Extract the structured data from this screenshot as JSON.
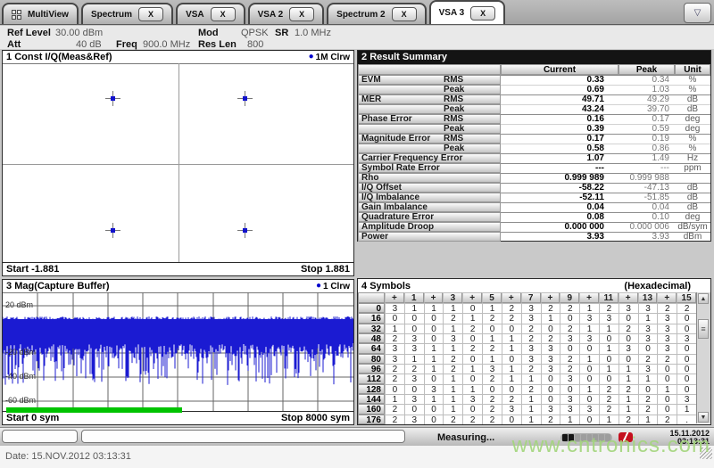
{
  "tabs": {
    "close_label": "X",
    "overflow_button": "▽",
    "items": [
      {
        "label": "MultiView",
        "icon": "grid",
        "closable": false,
        "active": false
      },
      {
        "label": "Spectrum",
        "closable": true,
        "active": false
      },
      {
        "label": "VSA",
        "closable": true,
        "active": false
      },
      {
        "label": "VSA 2",
        "closable": true,
        "active": false
      },
      {
        "label": "Spectrum 2",
        "closable": true,
        "active": false
      },
      {
        "label": "VSA 3",
        "closable": true,
        "active": true
      }
    ]
  },
  "infobar": {
    "ref_level": {
      "label": "Ref Level",
      "value": "30.00 dBm"
    },
    "att": {
      "label": "Att",
      "value": "40 dB"
    },
    "freq": {
      "label": "Freq",
      "value": "900.0 MHz"
    },
    "mod": {
      "label": "Mod",
      "value": "QPSK"
    },
    "sr": {
      "label": "SR",
      "value": "1.0 MHz"
    },
    "res_len": {
      "label": "Res Len",
      "value": "800"
    }
  },
  "panels": {
    "const_iq": {
      "num": "1",
      "title": "Const I/Q(Meas&Ref)",
      "legend_marker": "●",
      "legend": "1M Clrw",
      "start": "Start -1.881",
      "stop": "Stop 1.881",
      "x_range": [
        -1.881,
        1.881
      ],
      "points": [
        {
          "i": -0.707,
          "q": 0.707
        },
        {
          "i": 0.707,
          "q": 0.707
        },
        {
          "i": -0.707,
          "q": -0.707
        },
        {
          "i": 0.707,
          "q": -0.707
        }
      ]
    },
    "result_summary": {
      "num": "2",
      "title": "Result Summary",
      "columns": [
        "Current",
        "Peak",
        "Unit"
      ],
      "rows": [
        {
          "label": "EVM",
          "sub": "RMS",
          "current": "0.33",
          "peak": "0.34",
          "unit": "%"
        },
        {
          "label": "",
          "sub": "Peak",
          "current": "0.69",
          "peak": "1.03",
          "unit": "%"
        },
        {
          "label": "MER",
          "sub": "RMS",
          "current": "49.71",
          "peak": "49.29",
          "unit": "dB"
        },
        {
          "label": "",
          "sub": "Peak",
          "current": "43.24",
          "peak": "39.70",
          "unit": "dB"
        },
        {
          "label": "Phase Error",
          "sub": "RMS",
          "current": "0.16",
          "peak": "0.17",
          "unit": "deg"
        },
        {
          "label": "",
          "sub": "Peak",
          "current": "0.39",
          "peak": "0.59",
          "unit": "deg"
        },
        {
          "label": "Magnitude Error",
          "sub": "RMS",
          "current": "0.17",
          "peak": "0.19",
          "unit": "%"
        },
        {
          "label": "",
          "sub": "Peak",
          "current": "0.58",
          "peak": "0.86",
          "unit": "%"
        },
        {
          "label": "Carrier Frequency Error",
          "sub": "",
          "current": "1.07",
          "peak": "1.49",
          "unit": "Hz"
        },
        {
          "label": "Symbol Rate Error",
          "sub": "",
          "current": "---",
          "peak": "---",
          "unit": "ppm"
        },
        {
          "label": "Rho",
          "sub": "",
          "current": "0.999 989",
          "peak": "0.999 988",
          "unit": ""
        },
        {
          "label": "I/Q Offset",
          "sub": "",
          "current": "-58.22",
          "peak": "-47.13",
          "unit": "dB"
        },
        {
          "label": "I/Q Imbalance",
          "sub": "",
          "current": "-52.11",
          "peak": "-51.85",
          "unit": "dB"
        },
        {
          "label": "Gain Imbalance",
          "sub": "",
          "current": "0.04",
          "peak": "0.04",
          "unit": "dB"
        },
        {
          "label": "Quadrature Error",
          "sub": "",
          "current": "0.08",
          "peak": "0.10",
          "unit": "deg"
        },
        {
          "label": "Amplitude Droop",
          "sub": "",
          "current": "0.000 000",
          "peak": "0.000 006",
          "unit": "dB/sym"
        },
        {
          "label": "Power",
          "sub": "",
          "current": "3.93",
          "peak": "3.93",
          "unit": "dBm"
        }
      ]
    },
    "mag_capture": {
      "num": "3",
      "title": "Mag(Capture Buffer)",
      "legend_marker": "●",
      "legend": "1 Clrw",
      "start": "Start 0 sym",
      "stop": "Stop 8000 sym",
      "y_labels": [
        "20 dBm",
        "-20 dBm",
        "-40 dBm",
        "-60 dBm"
      ],
      "signal_band_dbm": [
        8,
        -12
      ],
      "noise_spikes_to_dbm": -50,
      "green_bar_fraction": 0.5
    },
    "symbols": {
      "num": "4",
      "title": "Symbols",
      "note": "(Hexadecimal)",
      "scrollbar": {
        "up": "▲",
        "down": "▼",
        "grip": "≡"
      },
      "col_headers": [
        "+",
        "1",
        "+",
        "3",
        "+",
        "5",
        "+",
        "7",
        "+",
        "9",
        "+",
        "11",
        "+",
        "13",
        "+",
        "15"
      ],
      "rows": [
        {
          "addr": "0",
          "values": [
            "3",
            "1",
            "1",
            "1",
            "0",
            "1",
            "2",
            "3",
            "2",
            "2",
            "1",
            "2",
            "3",
            "3",
            "2",
            "2"
          ]
        },
        {
          "addr": "16",
          "values": [
            "0",
            "0",
            "0",
            "2",
            "1",
            "2",
            "2",
            "3",
            "1",
            "0",
            "3",
            "3",
            "0",
            "1",
            "3",
            "0"
          ]
        },
        {
          "addr": "32",
          "values": [
            "1",
            "0",
            "0",
            "1",
            "2",
            "0",
            "0",
            "2",
            "0",
            "2",
            "1",
            "1",
            "2",
            "3",
            "3",
            "0"
          ]
        },
        {
          "addr": "48",
          "values": [
            "2",
            "3",
            "0",
            "3",
            "0",
            "1",
            "1",
            "2",
            "2",
            "3",
            "3",
            "0",
            "0",
            "3",
            "3",
            "3"
          ]
        },
        {
          "addr": "64",
          "values": [
            "3",
            "3",
            "1",
            "1",
            "2",
            "2",
            "1",
            "3",
            "3",
            "0",
            "0",
            "1",
            "3",
            "0",
            "3",
            "0"
          ]
        },
        {
          "addr": "80",
          "values": [
            "3",
            "1",
            "1",
            "2",
            "0",
            "1",
            "0",
            "3",
            "3",
            "2",
            "1",
            "0",
            "0",
            "2",
            "2",
            "0"
          ]
        },
        {
          "addr": "96",
          "values": [
            "2",
            "2",
            "1",
            "2",
            "1",
            "3",
            "1",
            "2",
            "3",
            "2",
            "0",
            "1",
            "1",
            "3",
            "0",
            "0"
          ]
        },
        {
          "addr": "112",
          "values": [
            "2",
            "3",
            "0",
            "1",
            "0",
            "2",
            "1",
            "1",
            "0",
            "3",
            "0",
            "0",
            "1",
            "1",
            "0",
            "0"
          ]
        },
        {
          "addr": "128",
          "values": [
            "0",
            "0",
            "3",
            "1",
            "1",
            "0",
            "0",
            "2",
            "0",
            "0",
            "1",
            "2",
            "2",
            "0",
            "1",
            "0"
          ]
        },
        {
          "addr": "144",
          "values": [
            "1",
            "3",
            "1",
            "1",
            "3",
            "2",
            "2",
            "1",
            "0",
            "3",
            "0",
            "2",
            "1",
            "2",
            "0",
            "3"
          ]
        },
        {
          "addr": "160",
          "values": [
            "2",
            "0",
            "0",
            "1",
            "0",
            "2",
            "3",
            "1",
            "3",
            "3",
            "3",
            "2",
            "1",
            "2",
            "0",
            "1"
          ]
        },
        {
          "addr": "176",
          "values": [
            "2",
            "3",
            "0",
            "2",
            "2",
            "2",
            "0",
            "1",
            "2",
            "1",
            "0",
            "1",
            "2",
            "1",
            "2",
            "."
          ]
        }
      ]
    }
  },
  "statusbar": {
    "measuring": "Measuring...",
    "progress": {
      "segments": 8,
      "filled": 2
    },
    "date": "15.11.2012",
    "time": "03:13:31"
  },
  "footer": {
    "date_text": "Date: 15.NOV.2012  03:13:31",
    "watermark": "www.cntronics.com"
  },
  "colors": {
    "trace_blue": "#1b1bd2",
    "marker_blue": "#1111cc",
    "green_bar": "#00c300",
    "alert_red": "#c40f1e",
    "watermark_green": "#a3d57d"
  }
}
